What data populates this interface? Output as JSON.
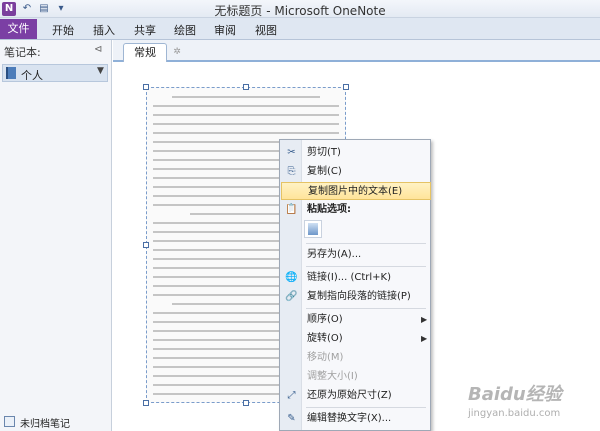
{
  "window": {
    "title": "无标题页 - Microsoft OneNote",
    "app_icon": "N"
  },
  "ribbon": {
    "file_tab": "文件",
    "tabs": [
      "开始",
      "插入",
      "共享",
      "绘图",
      "审阅",
      "视图"
    ]
  },
  "nav": {
    "header": "笔记本:",
    "notebook": "个人",
    "footer": "未归档笔记"
  },
  "sections": {
    "active": "常规"
  },
  "context_menu": {
    "items": [
      {
        "label": "剪切(T)",
        "icon": "scissors-icon",
        "glyph": "✂"
      },
      {
        "label": "复制(C)",
        "icon": "copy-icon",
        "glyph": "⎘"
      },
      {
        "label": "复制图片中的文本(E)",
        "highlighted": true
      },
      {
        "label": "粘贴选项:",
        "icon": "paste-icon",
        "glyph": "📋",
        "bold": true
      },
      {
        "label": "另存为(A)..."
      },
      {
        "label": "链接(I)...  (Ctrl+K)",
        "icon": "link-icon",
        "glyph": "🌐"
      },
      {
        "label": "复制指向段落的链接(P)",
        "icon": "paragraph-link-icon",
        "glyph": "🔗"
      },
      {
        "label": "顺序(O)",
        "submenu": true
      },
      {
        "label": "旋转(O)",
        "submenu": true
      },
      {
        "label": "移动(M)",
        "disabled": true
      },
      {
        "label": "调整大小(I)",
        "disabled": true
      },
      {
        "label": "还原为原始尺寸(Z)",
        "icon": "restore-size-icon",
        "glyph": "⤢"
      },
      {
        "label": "编辑替换文字(X)...",
        "icon": "alt-text-icon",
        "glyph": "✎"
      }
    ]
  },
  "watermark": {
    "logo": "Baidu经验",
    "url": "jingyan.baidu.com"
  },
  "colors": {
    "file_tab": "#7b3fa4",
    "highlight": "#ffe49a",
    "accent": "#8fb0d8"
  }
}
